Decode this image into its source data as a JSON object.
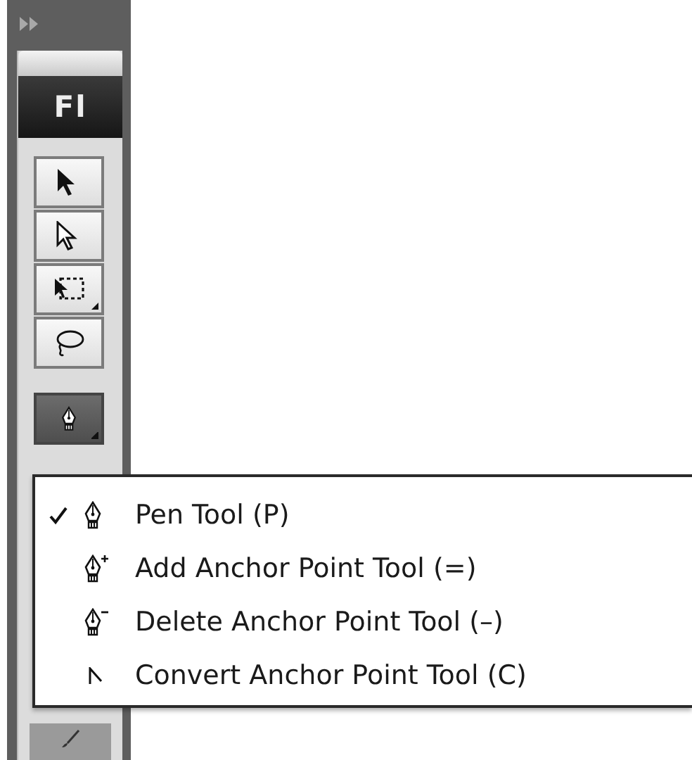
{
  "toolbar": {
    "logo": "Fl",
    "tools": [
      {
        "kind": "selection",
        "selected": false,
        "has_menu": false
      },
      {
        "kind": "subselection",
        "selected": false,
        "has_menu": false
      },
      {
        "kind": "transform",
        "selected": false,
        "has_menu": true
      },
      {
        "kind": "lasso",
        "selected": false,
        "has_menu": false
      },
      {
        "kind": "pen",
        "selected": true,
        "has_menu": true
      }
    ],
    "lower_tools": [
      {
        "kind": "brush"
      }
    ]
  },
  "menu": {
    "items": [
      {
        "kind": "pen",
        "label": "Pen Tool (P)",
        "checked": true
      },
      {
        "kind": "add",
        "label": "Add Anchor Point Tool (=)",
        "checked": false
      },
      {
        "kind": "delete",
        "label": "Delete Anchor Point Tool (–)",
        "checked": false
      },
      {
        "kind": "convert",
        "label": "Convert Anchor Point Tool (C)",
        "checked": false
      }
    ]
  }
}
